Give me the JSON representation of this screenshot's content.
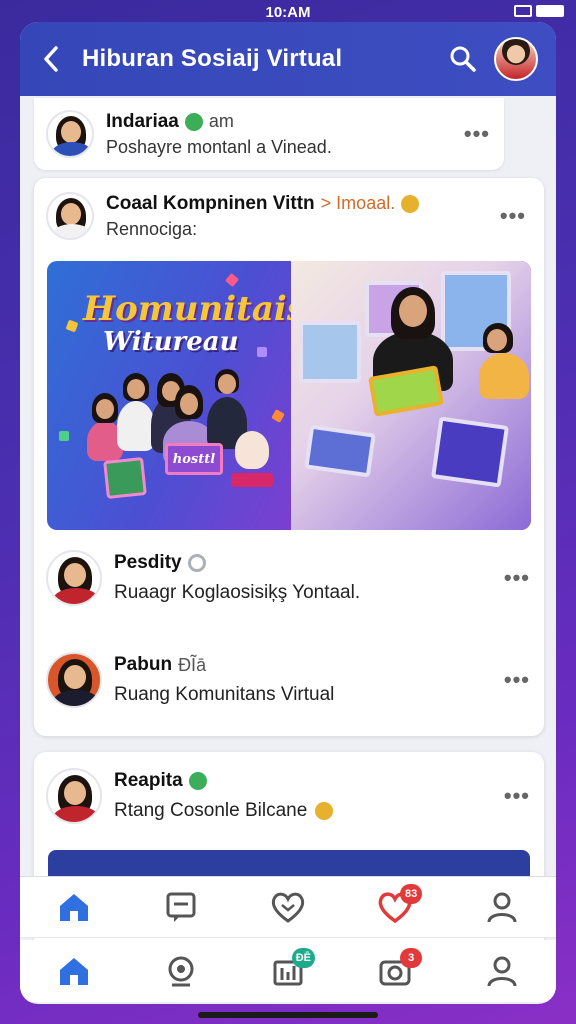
{
  "status": {
    "time": "10:AM"
  },
  "header": {
    "title": "Hiburan Sosiaij Virtual"
  },
  "posts_top": {
    "name": "Indariaa",
    "extra": "am",
    "sub": "Poshayre montanl a Vinead."
  },
  "featured": {
    "name": "Coaal Kompninen Vittn",
    "tag": "> Imoaal.",
    "sub": "Rennociga:",
    "banner_title": "Homunitais",
    "banner_sub": "Witureau",
    "banner_sign": "hosttl"
  },
  "rows": [
    {
      "name": "Pesdity",
      "sub": "Ruaagr Koglaosisiķş Yontaal."
    },
    {
      "name": "Pabun",
      "badge": "ĐĨā",
      "sub": "Ruang Komunitans Virtual"
    }
  ],
  "bottom_post": {
    "name": "Reapita",
    "sub": "Rtang Cosonle Bilcane"
  },
  "nav_badges": {
    "heart": "83",
    "stats": "ĐĒ",
    "camera": "3"
  },
  "colors": {
    "header": "#3547b8",
    "nav_active": "#2f6fe0",
    "badge_red": "#e23a3a",
    "badge_teal": "#1faa8c"
  }
}
